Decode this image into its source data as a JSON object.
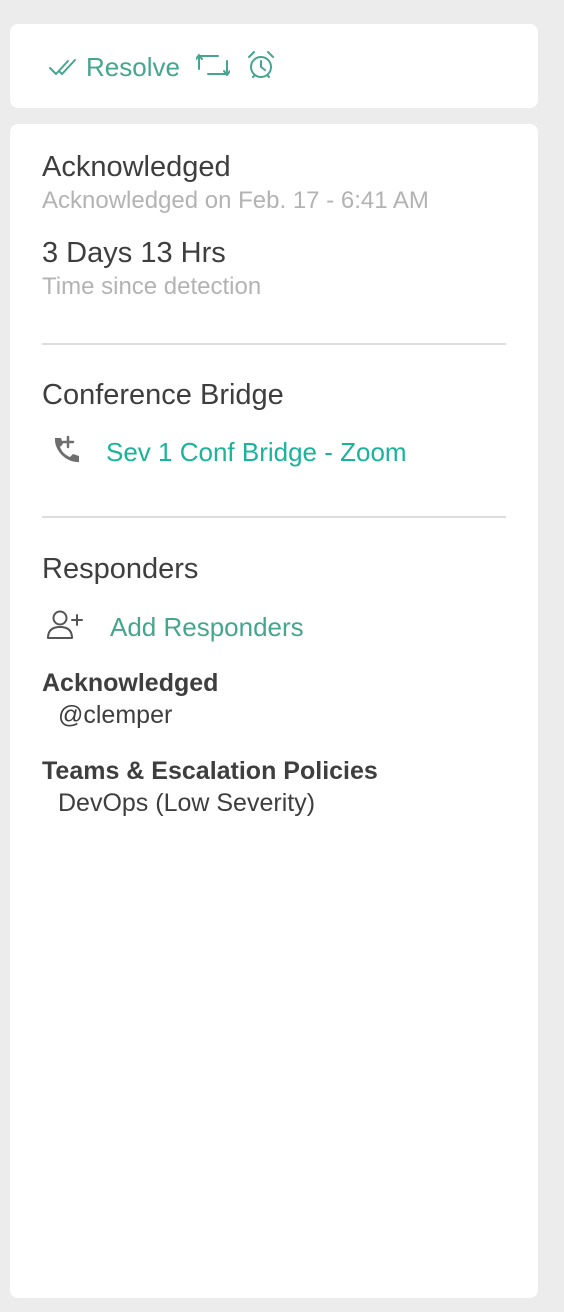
{
  "actions": {
    "resolve_label": "Resolve",
    "resolve_icon": "double-check-icon",
    "reassign_icon": "reassign-icon",
    "snooze_icon": "alarm-clock-icon",
    "accent_color": "#45a690"
  },
  "status": {
    "title": "Acknowledged",
    "subtitle": "Acknowledged on Feb. 17 - 6:41 AM",
    "duration": "3 Days 13 Hrs",
    "duration_label": "Time since detection"
  },
  "conference_bridge": {
    "title": "Conference Bridge",
    "link_label": "Sev 1 Conf Bridge - Zoom",
    "icon": "phone-add-icon",
    "link_color": "#1ab49a"
  },
  "responders": {
    "title": "Responders",
    "add_label": "Add Responders",
    "add_icon": "user-add-icon",
    "groups": [
      {
        "label": "Acknowledged",
        "value": "@clemper"
      },
      {
        "label": "Teams & Escalation Policies",
        "value": "DevOps (Low Severity)"
      }
    ]
  }
}
